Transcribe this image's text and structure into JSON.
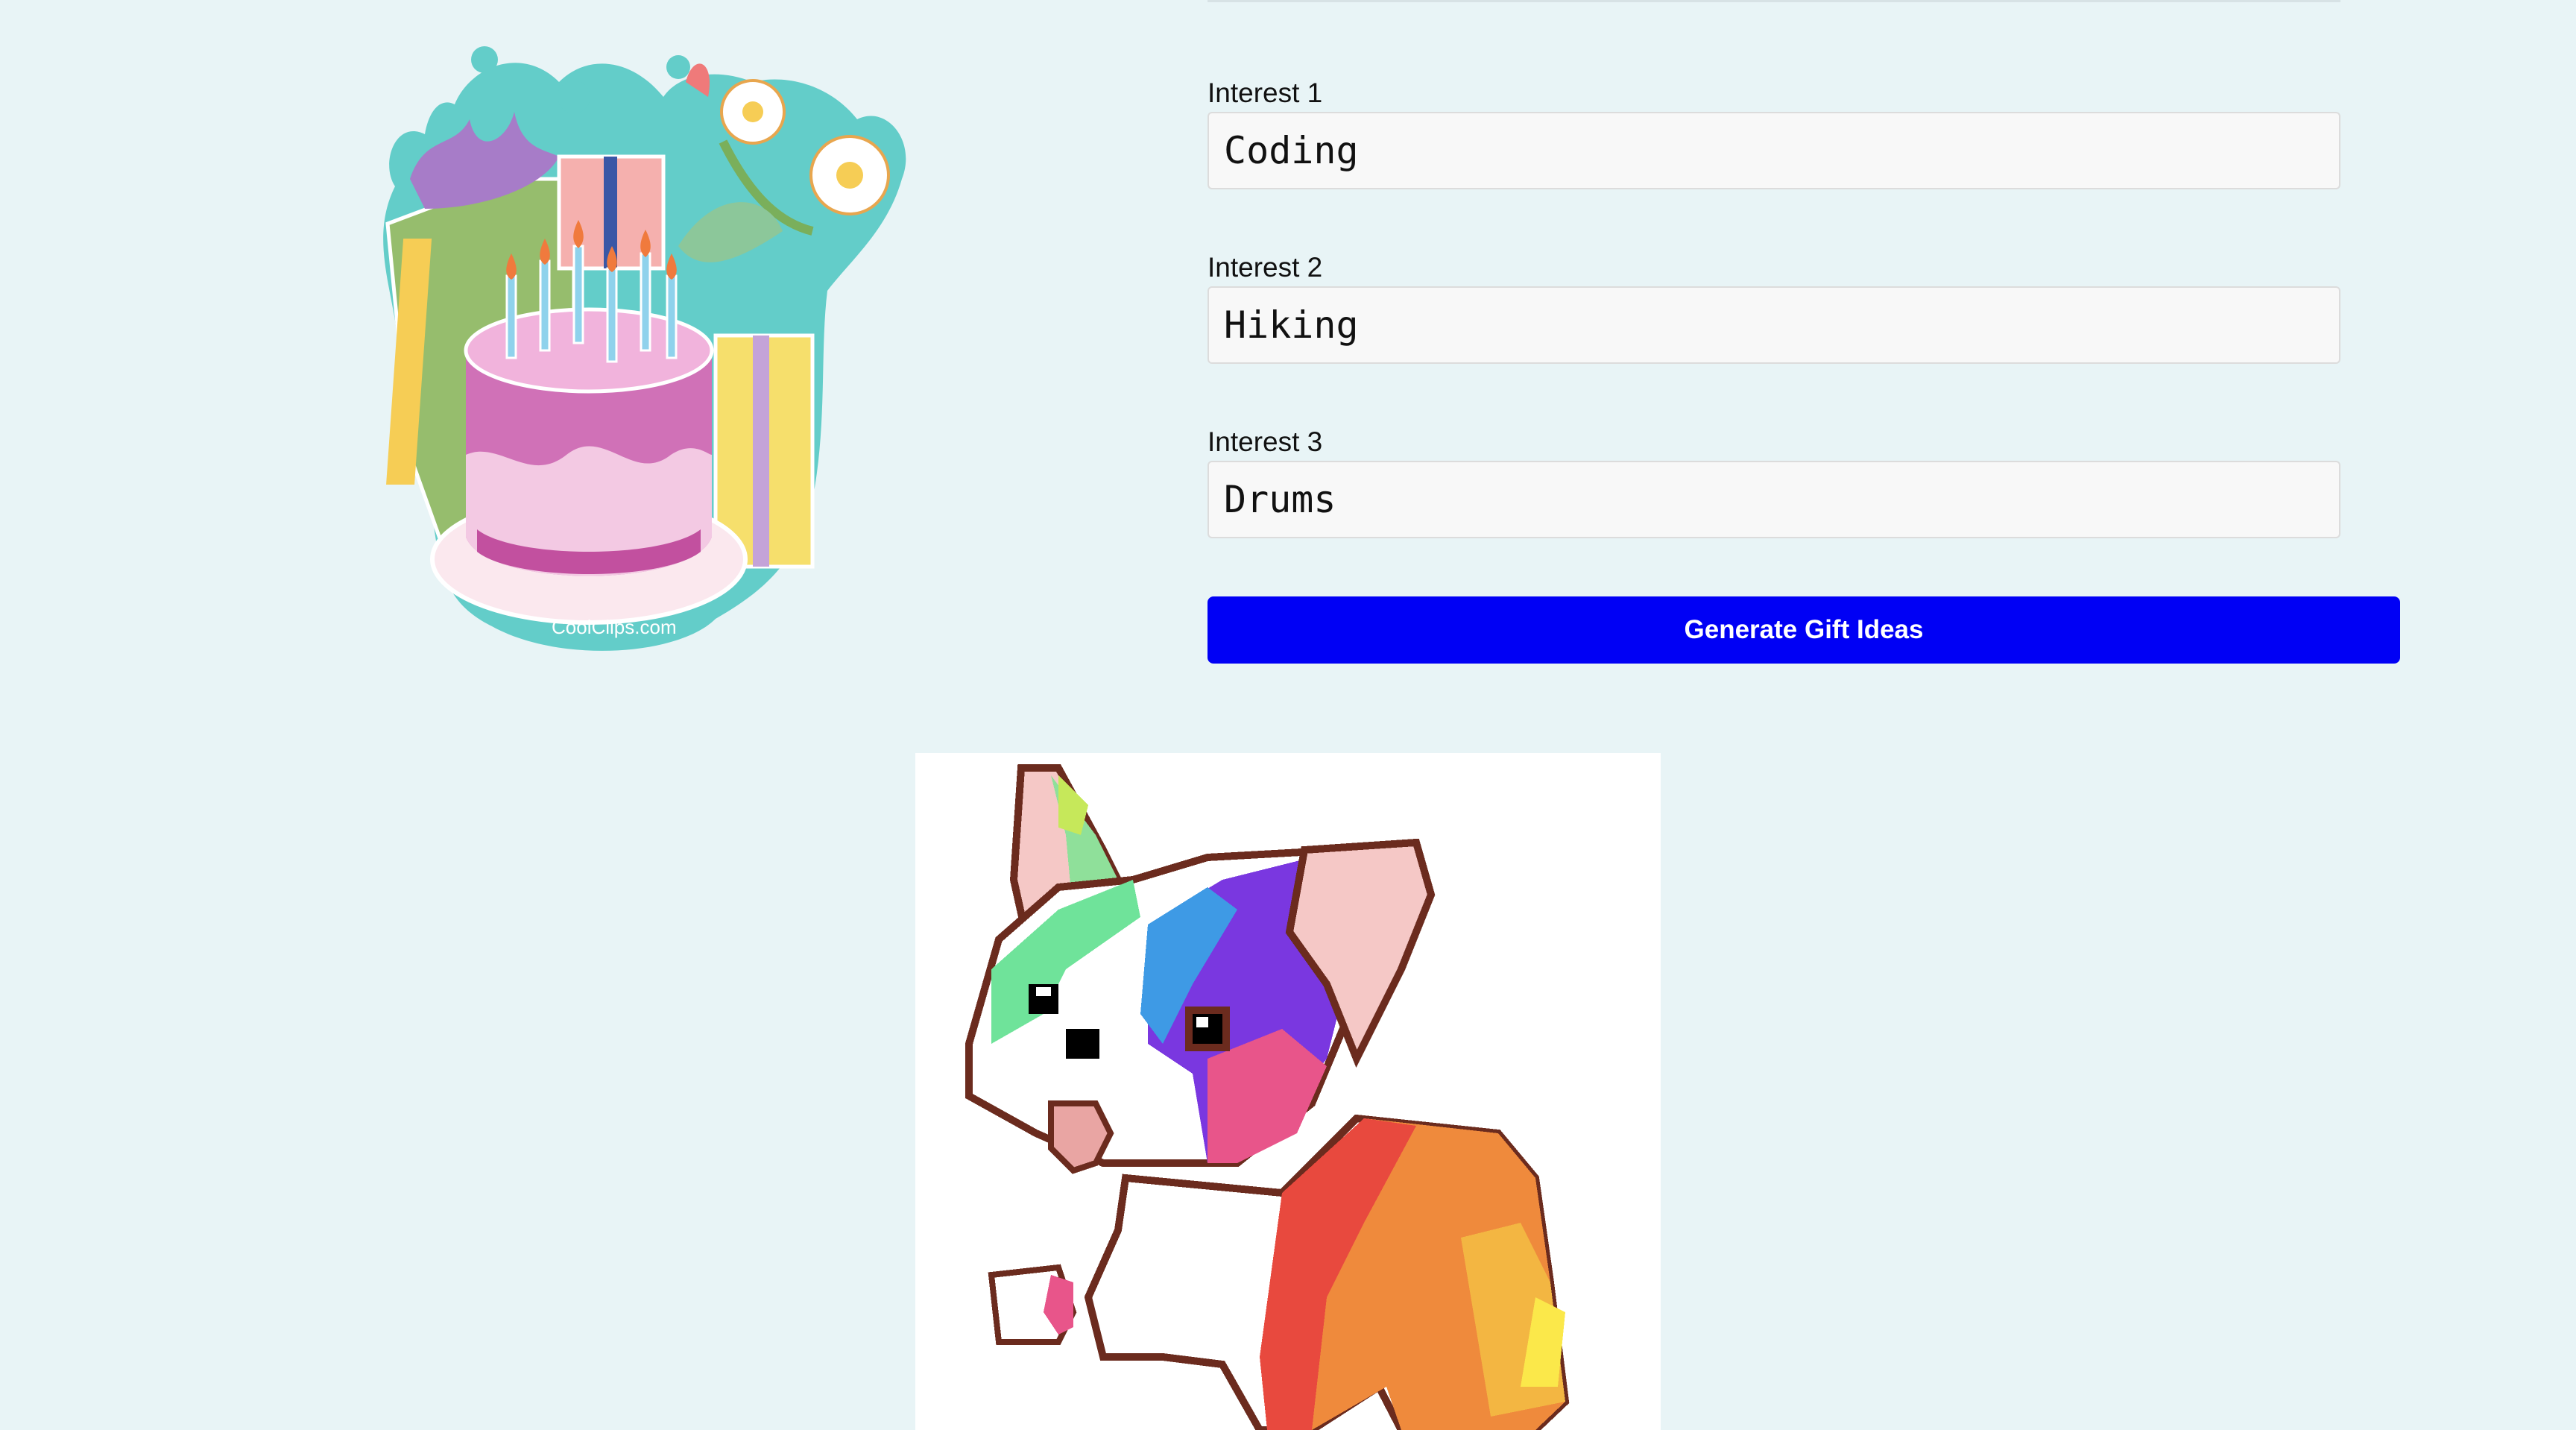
{
  "form": {
    "fields": [
      {
        "label": "Interest 1",
        "value": "Coding"
      },
      {
        "label": "Interest 2",
        "value": "Hiking"
      },
      {
        "label": "Interest 3",
        "value": "Drums"
      }
    ],
    "submit_label": "Generate Gift Ideas"
  },
  "images": {
    "cake": {
      "icon": "birthday-cake-gifts-illustration",
      "watermark": "CoolClips.com"
    },
    "corgi": {
      "icon": "rainbow-pixel-corgi-illustration"
    }
  },
  "colors": {
    "background": "#e8f4f6",
    "button": "#0000f5",
    "button_text": "#ffffff"
  }
}
